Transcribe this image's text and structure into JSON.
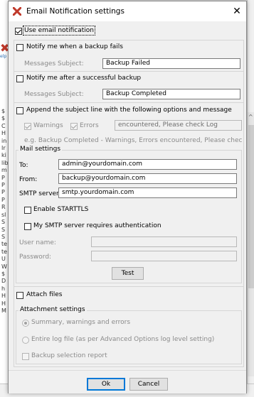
{
  "window": {
    "title": "Email Notification settings"
  },
  "use_email": {
    "label": "Use email notification",
    "checked": true
  },
  "backup_fail": {
    "label": "Notify me when a backup fails",
    "subject_label": "Messages Subject:",
    "subject_value": "Backup Failed"
  },
  "backup_success": {
    "label": "Notify me after a successful backup",
    "subject_label": "Messages Subject:",
    "subject_value": "Backup Completed"
  },
  "append": {
    "label": "Append the subject line with the following options and message",
    "warnings_label": "Warnings",
    "errors_label": "Errors",
    "message_value": "encountered, Please check Log",
    "example_text": "e.g. Backup Completed - Warnings, Errors encountered, Please check Log"
  },
  "mail_settings": {
    "group_label": "Mail settings",
    "to_label": "To:",
    "to_value": "admin@yourdomain.com",
    "from_label": "From:",
    "from_value": "backup@yourdomain.com",
    "smtp_label": "SMTP server:",
    "smtp_value": "smtp.yourdomain.com",
    "starttls_label": "Enable STARTTLS",
    "auth_label": "My SMTP server requires authentication",
    "username_label": "User name:",
    "password_label": "Password:",
    "test_label": "Test"
  },
  "attach": {
    "label": "Attach files",
    "group_label": "Attachment settings",
    "summary_label": "Summary, warnings and errors",
    "entire_log_label": "Entire log file (as per Advanced Options log level setting)",
    "selection_report_label": "Backup selection report"
  },
  "footer": {
    "ok_label": "Ok",
    "cancel_label": "Cancel"
  },
  "background": {
    "logo_label": "elp",
    "text_column": "$\n$\nC\nH\nin\nIr\nki\nlib\nm\nP\nP\nP\nP\nR\nsl\nS\nS\nS\nte\nte\nU\nW\n$\nD\nh\nH\nH\nM"
  },
  "colors": {
    "focus_ring": "#0078d7",
    "app_icon": "#c0392b"
  }
}
